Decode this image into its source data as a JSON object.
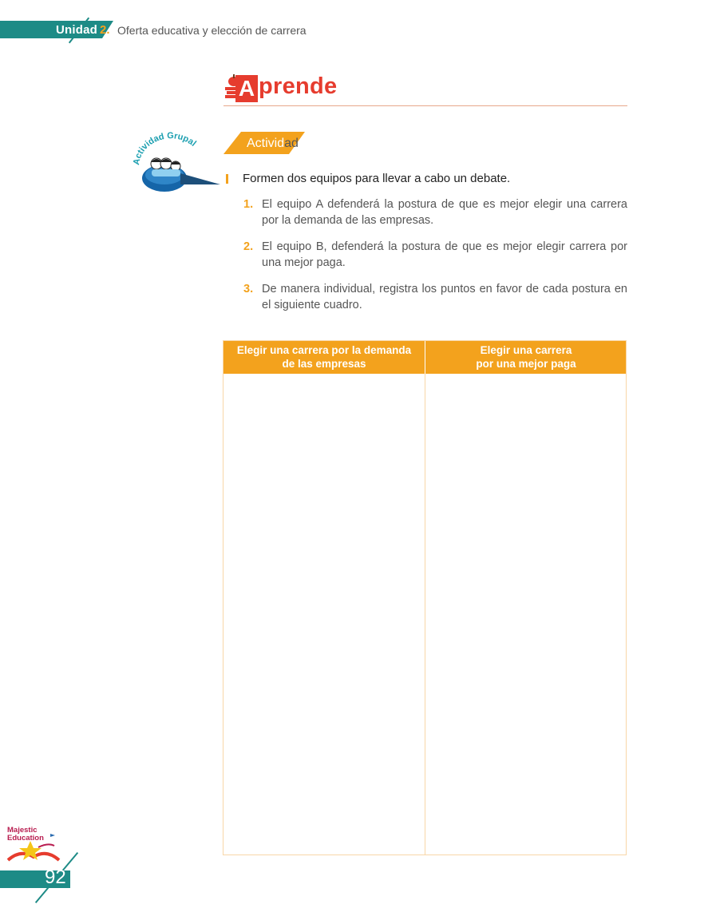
{
  "header": {
    "unit_label": "Unidad",
    "unit_number": "2.",
    "title": "Oferta educativa y elección de carrera"
  },
  "section": {
    "title_initial": "A",
    "title_rest": "prende"
  },
  "activity": {
    "tag_main": "Activid",
    "tag_tail": "ad",
    "badge_text": "Actividad Grupal",
    "instruction": "Formen dos equipos para llevar a cabo un debate.",
    "items": [
      {
        "num": "1.",
        "text": "El equipo A defenderá la postura de que es mejor elegir una carrera por la demanda de las empresas."
      },
      {
        "num": "2.",
        "text": "El equipo B, defenderá la postura de que es mejor elegir carrera por una mejor paga."
      },
      {
        "num": "3.",
        "text": "De manera individual, registra los puntos en favor de cada postura en el siguiente cuadro."
      }
    ]
  },
  "table": {
    "headers": [
      {
        "line1": "Elegir una carrera por la demanda",
        "line2": "de las empresas"
      },
      {
        "line1": "Elegir una carrera",
        "line2": "por una mejor paga"
      }
    ]
  },
  "footer": {
    "logo_line1": "Majestic",
    "logo_line2": "Education",
    "page_number": "92"
  },
  "colors": {
    "teal": "#1d8b86",
    "orange": "#f3a21d",
    "red": "#e63c2e"
  }
}
